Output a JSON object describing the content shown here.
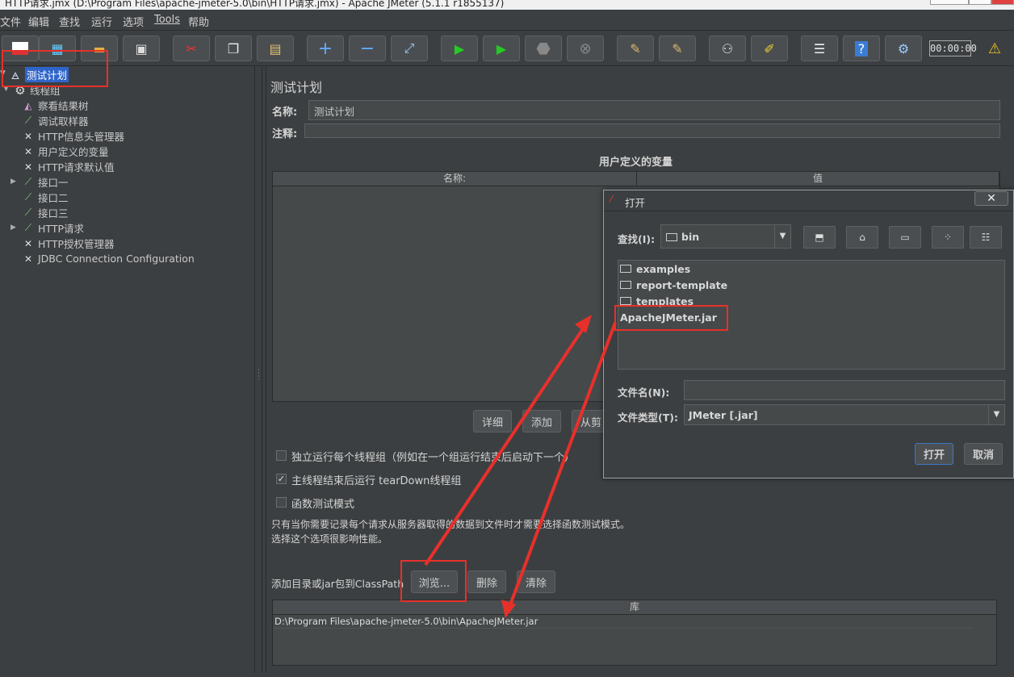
{
  "window": {
    "title": "HTTP请求.jmx (D:\\Program Files\\apache-jmeter-5.0\\bin\\HTTP请求.jmx) - Apache JMeter (5.1.1 r1855137)"
  },
  "menu": [
    "文件",
    "编辑",
    "查找",
    "运行",
    "选项",
    "Tools",
    "帮助"
  ],
  "toolbar": {
    "timer": "00:00:00",
    "warning_icon": "warning-icon"
  },
  "tree": {
    "items": [
      {
        "label": "测试计划",
        "icon": "flask-icon"
      },
      {
        "label": "线程组",
        "icon": "gear-icon"
      },
      {
        "label": "察看结果树",
        "icon": "chart-icon"
      },
      {
        "label": "调试取样器",
        "icon": "pipette-icon"
      },
      {
        "label": "HTTP信息头管理器",
        "icon": "wrench-icon"
      },
      {
        "label": "用户定义的变量",
        "icon": "wrench-icon"
      },
      {
        "label": "HTTP请求默认值",
        "icon": "wrench-icon"
      },
      {
        "label": "接口一",
        "icon": "pipette-icon"
      },
      {
        "label": "接口二",
        "icon": "pipette-icon"
      },
      {
        "label": "接口三",
        "icon": "pipette-icon"
      },
      {
        "label": "HTTP请求",
        "icon": "pipette-icon"
      },
      {
        "label": "HTTP授权管理器",
        "icon": "wrench-icon"
      },
      {
        "label": "JDBC Connection Configuration",
        "icon": "wrench-icon"
      }
    ]
  },
  "testplan": {
    "heading": "测试计划",
    "name_label": "名称:",
    "name_value": "测试计划",
    "comment_label": "注释:",
    "vars_title": "用户定义的变量",
    "col_name": "名称:",
    "col_value": "值",
    "btn_detail": "详细",
    "btn_add": "添加",
    "btn_clip": "从剪",
    "opt1": "独立运行每个线程组（例如在一个组运行结束后启动下一个）",
    "opt2": "主线程结束后运行 tearDown线程组",
    "opt3": "函数测试模式",
    "note1": "只有当你需要记录每个请求从服务器取得的数据到文件时才需要选择函数测试模式。",
    "note2": "选择这个选项很影响性能。",
    "classpath_label": "添加目录或jar包到ClassPath",
    "btn_browse": "浏览...",
    "btn_delete": "删除",
    "btn_clear": "清除",
    "lib_header": "库",
    "lib_row": "D:\\Program Files\\apache-jmeter-5.0\\bin\\ApacheJMeter.jar"
  },
  "dialog": {
    "title": "打开",
    "lookin_label": "查找(I):",
    "lookin_value": "bin",
    "files": [
      "examples",
      "report-template",
      "templates",
      "ApacheJMeter.jar"
    ],
    "filename_label": "文件名(N):",
    "filename_value": "",
    "filetype_label": "文件类型(T):",
    "filetype_value": "JMeter [.jar]",
    "btn_open": "打开",
    "btn_cancel": "取消",
    "close": "✕"
  },
  "colors": {
    "annotation": "#e8302a",
    "selection": "#2f65ca"
  }
}
